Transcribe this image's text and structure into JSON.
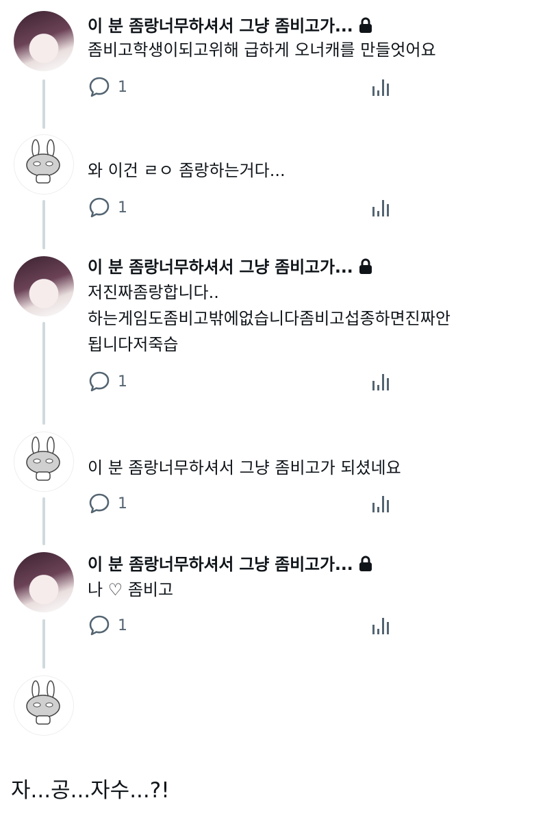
{
  "thread": [
    {
      "author": "이 분 좀랑너무하셔서 그냥 좀비고가...",
      "avatar": "girl-avatar",
      "locked": true,
      "lines": [
        "좀비고학생이되고위해 급하게 오너캐를 만들엇어요"
      ],
      "reply_count": "1"
    },
    {
      "author": "",
      "avatar": "bunny-avatar",
      "locked": false,
      "lines": [
        "와 이건 ㄹㅇ 좀랑하는거다..."
      ],
      "reply_count": "1"
    },
    {
      "author": "이 분 좀랑너무하셔서 그냥 좀비고가...",
      "avatar": "girl-avatar",
      "locked": true,
      "lines": [
        "저진짜좀랑합니다..",
        "하는게임도좀비고밖에없습니다좀비고섭종하면진짜안",
        "됩니다저죽습"
      ],
      "reply_count": "1"
    },
    {
      "author": "",
      "avatar": "bunny-avatar",
      "locked": false,
      "lines": [
        "이 분 좀랑너무하셔서 그냥 좀비고가 되셨네요"
      ],
      "reply_count": "1"
    },
    {
      "author": "이 분 좀랑너무하셔서 그냥 좀비고가...",
      "avatar": "girl-avatar",
      "locked": true,
      "lines": [
        "나 ♡ 좀비고"
      ],
      "reply_count": "1"
    }
  ],
  "caption": "자...공...자수...?!",
  "colors": {
    "text": "#0f1419",
    "muted": "#536471",
    "thread_line": "#cfd9de"
  }
}
